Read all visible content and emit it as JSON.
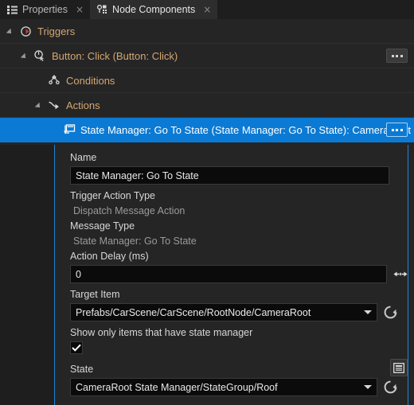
{
  "window": {
    "background": "#252526",
    "accent": "#0b7ad4",
    "tree_text_color": "#d3a771"
  },
  "tabs": [
    {
      "label": "Properties",
      "icon": "list-icon",
      "active": false,
      "close_label": "×"
    },
    {
      "label": "Node Components",
      "icon": "node-components-icon",
      "active": true,
      "close_label": "×"
    }
  ],
  "tree": [
    {
      "label": "Triggers",
      "icon": "trigger-icon",
      "depth": 0,
      "expanded": true,
      "has_twisty": true,
      "selected": false,
      "has_menu": false
    },
    {
      "label": "Button: Click (Button: Click)",
      "icon": "click-trigger-icon",
      "depth": 1,
      "expanded": true,
      "has_twisty": true,
      "selected": false,
      "has_menu": true
    },
    {
      "label": "Conditions",
      "icon": "conditions-icon",
      "depth": 2,
      "expanded": false,
      "has_twisty": false,
      "selected": false,
      "has_menu": false
    },
    {
      "label": "Actions",
      "icon": "actions-icon",
      "depth": 2,
      "expanded": true,
      "has_twisty": true,
      "selected": false,
      "has_menu": false
    },
    {
      "label": "State Manager: Go To State (State Manager: Go To State): CameraRoot",
      "icon": "action-node-icon",
      "depth": 3,
      "expanded": false,
      "has_twisty": false,
      "selected": true,
      "has_menu": true
    }
  ],
  "properties": {
    "name": {
      "label": "Name",
      "value": "State Manager: Go To State"
    },
    "trigger_action_type": {
      "label": "Trigger Action Type",
      "value": "Dispatch Message Action"
    },
    "message_type": {
      "label": "Message Type",
      "value": "State Manager: Go To State"
    },
    "action_delay": {
      "label": "Action Delay (ms)",
      "value": "0",
      "spinner_icon": "horizontal-drag-icon"
    },
    "target_item": {
      "label": "Target Item",
      "value": "Prefabs/CarScene/CarScene/RootNode/CameraRoot",
      "caret_icon": "chevron-down-icon",
      "reset_icon": "reset-icon"
    },
    "show_only_state_manager": {
      "label": "Show only items that have state manager",
      "checked": true,
      "check_icon": "checkmark-icon"
    },
    "state": {
      "label": "State",
      "value": "CameraRoot State Manager/StateGroup/Roof",
      "caret_icon": "chevron-down-icon",
      "reset_icon": "reset-icon",
      "picker_icon": "state-list-icon"
    }
  },
  "menu_button": {
    "name": "context-menu-button",
    "glyph": "ellipsis"
  }
}
